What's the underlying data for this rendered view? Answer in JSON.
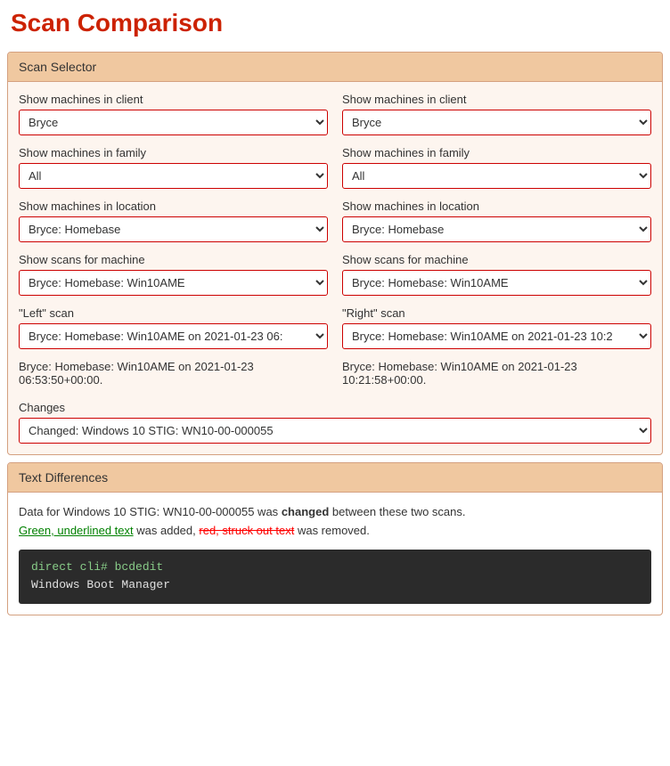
{
  "page": {
    "title": "Scan Comparison"
  },
  "scan_selector": {
    "panel_header": "Scan Selector",
    "left": {
      "client_label": "Show machines in client",
      "client_value": "Bryce",
      "family_label": "Show machines in family",
      "family_value": "All",
      "location_label": "Show machines in location",
      "location_value": "Bryce: Homebase",
      "machine_label": "Show scans for machine",
      "machine_value": "Bryce: Homebase: Win10AME",
      "scan_label": "\"Left\" scan",
      "scan_value": "Bryce: Homebase: Win10AME on 2021-01-23 06:",
      "scan_info": "Bryce: Homebase: Win10AME on 2021-01-23 06:53:50+00:00."
    },
    "right": {
      "client_label": "Show machines in client",
      "client_value": "Bryce",
      "family_label": "Show machines in family",
      "family_value": "All",
      "location_label": "Show machines in location",
      "location_value": "Bryce: Homebase",
      "machine_label": "Show scans for machine",
      "machine_value": "Bryce: Homebase: Win10AME",
      "scan_label": "\"Right\" scan",
      "scan_value": "Bryce: Homebase: Win10AME on 2021-01-23 10:2",
      "scan_info": "Bryce: Homebase: Win10AME on 2021-01-23 10:21:58+00:00."
    },
    "changes_label": "Changes",
    "changes_value": "Changed: Windows 10 STIG: WN10-00-000055"
  },
  "text_differences": {
    "panel_header": "Text Differences",
    "description_prefix": "Data for Windows 10 STIG: WN10-00-000055 was",
    "changed_word": "changed",
    "description_middle": "between these two scans.",
    "added_label": "Green, underlined text",
    "added_suffix": "was added,",
    "removed_label": "red, struck out text",
    "removed_suffix": "was removed.",
    "code_line1": "direct cli# bcdedit",
    "code_line2": "Windows Boot Manager"
  }
}
